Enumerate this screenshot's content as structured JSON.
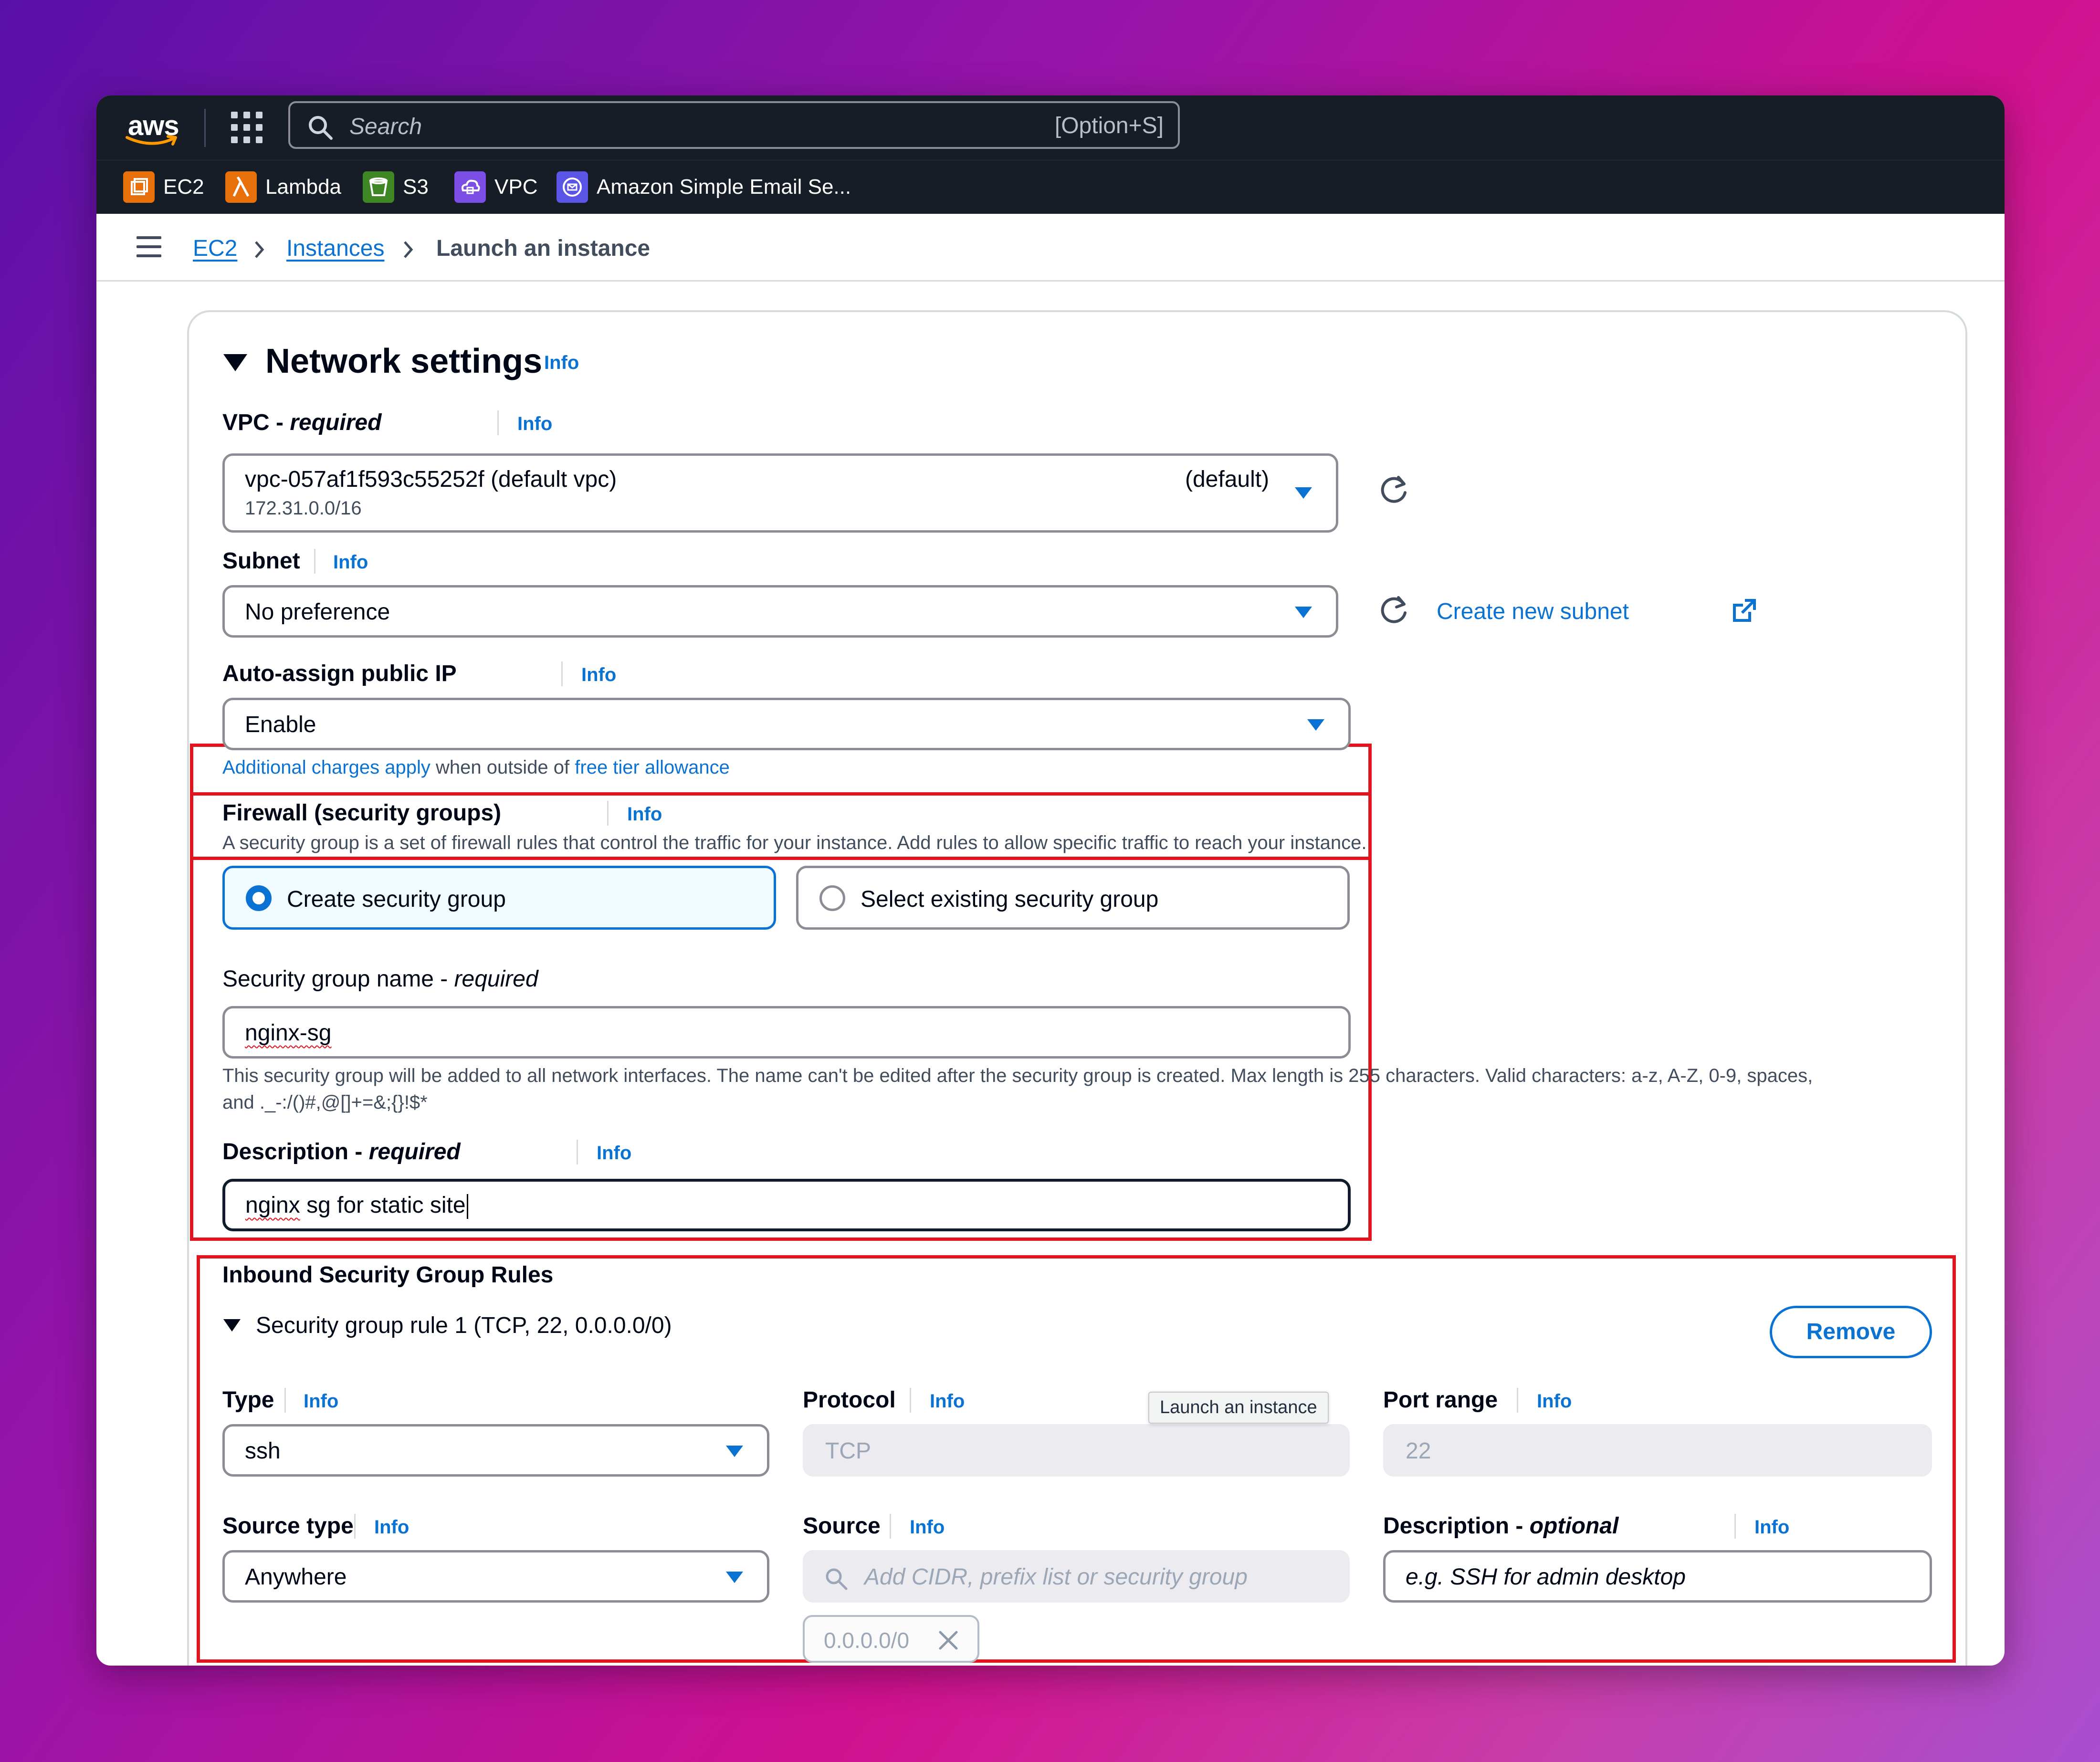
{
  "topbar": {
    "logo_text": "aws",
    "search_placeholder": "Search",
    "search_shortcut": "[Option+S]"
  },
  "services": [
    {
      "label": "EC2",
      "color": "#e8700b",
      "icon": "ec2-icon"
    },
    {
      "label": "Lambda",
      "color": "#e8700b",
      "icon": "lambda-icon"
    },
    {
      "label": "S3",
      "color": "#3f8624",
      "icon": "s3-icon"
    },
    {
      "label": "VPC",
      "color": "#7d4ee6",
      "icon": "vpc-icon"
    },
    {
      "label": "Amazon Simple Email Se...",
      "color": "#5a55e6",
      "icon": "ses-icon"
    }
  ],
  "breadcrumb": {
    "items": [
      "EC2",
      "Instances"
    ],
    "current": "Launch an instance"
  },
  "network": {
    "title": "Network settings",
    "info": "Info",
    "vpc": {
      "label": "VPC - ",
      "required": "required",
      "value": "vpc-057af1f593c55252f (default vpc)",
      "sub": "172.31.0.0/16",
      "tag": "(default)"
    },
    "subnet": {
      "label": "Subnet",
      "value": "No preference",
      "create_link": "Create new subnet"
    },
    "auto_ip": {
      "label": "Auto-assign public IP",
      "value": "Enable",
      "note_link1": "Additional charges apply",
      "note_mid": " when outside of ",
      "note_link2": "free tier allowance"
    },
    "firewall": {
      "label": "Firewall (security groups)",
      "desc": "A security group is a set of firewall rules that control the traffic for your instance. Add rules to allow specific traffic to reach your instance.",
      "option_create": "Create security group",
      "option_select": "Select existing security group",
      "sg_name_label": "Security group name - ",
      "sg_name_required": "required",
      "sg_name_value": "nginx-sg",
      "sg_name_hint1": "This security group will be added to all network interfaces. The name can't be edited after the security group is created. Max length is 255 characters. Valid characters: a-z, A-Z, 0-9, spaces,",
      "sg_name_hint2": "and ._-:/()#,@[]+=&;{}!$*",
      "desc_label": "Description - ",
      "desc_required": "required",
      "desc_value_a": "nginx",
      "desc_value_b": " sg for static site"
    },
    "inbound": {
      "title": "Inbound Security Group Rules",
      "rule_title": "Security group rule 1 (TCP, 22, 0.0.0.0/0)",
      "remove": "Remove",
      "type_label": "Type",
      "type_value": "ssh",
      "protocol_label": "Protocol",
      "protocol_value": "TCP",
      "tooltip": "Launch an instance",
      "port_label": "Port range",
      "port_value": "22",
      "source_type_label": "Source type",
      "source_type_value": "Anywhere",
      "source_label": "Source",
      "source_placeholder": "Add CIDR, prefix list or security group",
      "source_token": "0.0.0.0/0",
      "rdesc_label": "Description - ",
      "rdesc_optional": "optional",
      "rdesc_placeholder": "e.g. SSH for admin desktop"
    }
  }
}
